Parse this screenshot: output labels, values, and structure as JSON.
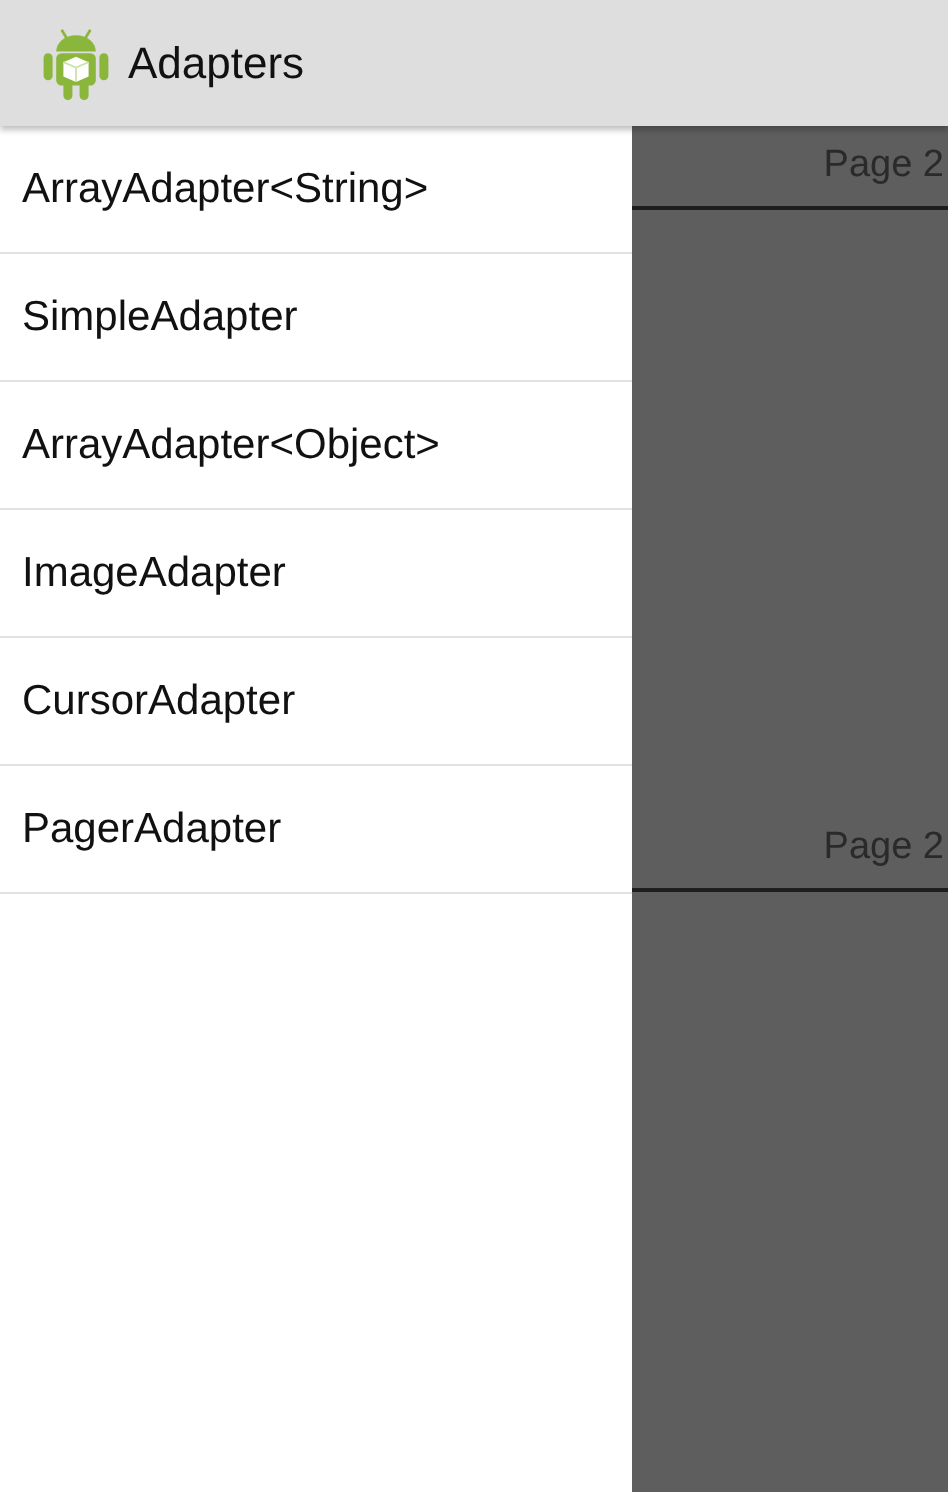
{
  "action_bar": {
    "title": "Adapters"
  },
  "drawer": {
    "items": [
      {
        "label": "ArrayAdapter<String>"
      },
      {
        "label": "SimpleAdapter"
      },
      {
        "label": "ArrayAdapter<Object>"
      },
      {
        "label": "ImageAdapter"
      },
      {
        "label": "CursorAdapter"
      },
      {
        "label": "PagerAdapter"
      }
    ]
  },
  "content": {
    "sections": [
      {
        "title": "Page 2"
      },
      {
        "title": "Page 2"
      }
    ]
  }
}
